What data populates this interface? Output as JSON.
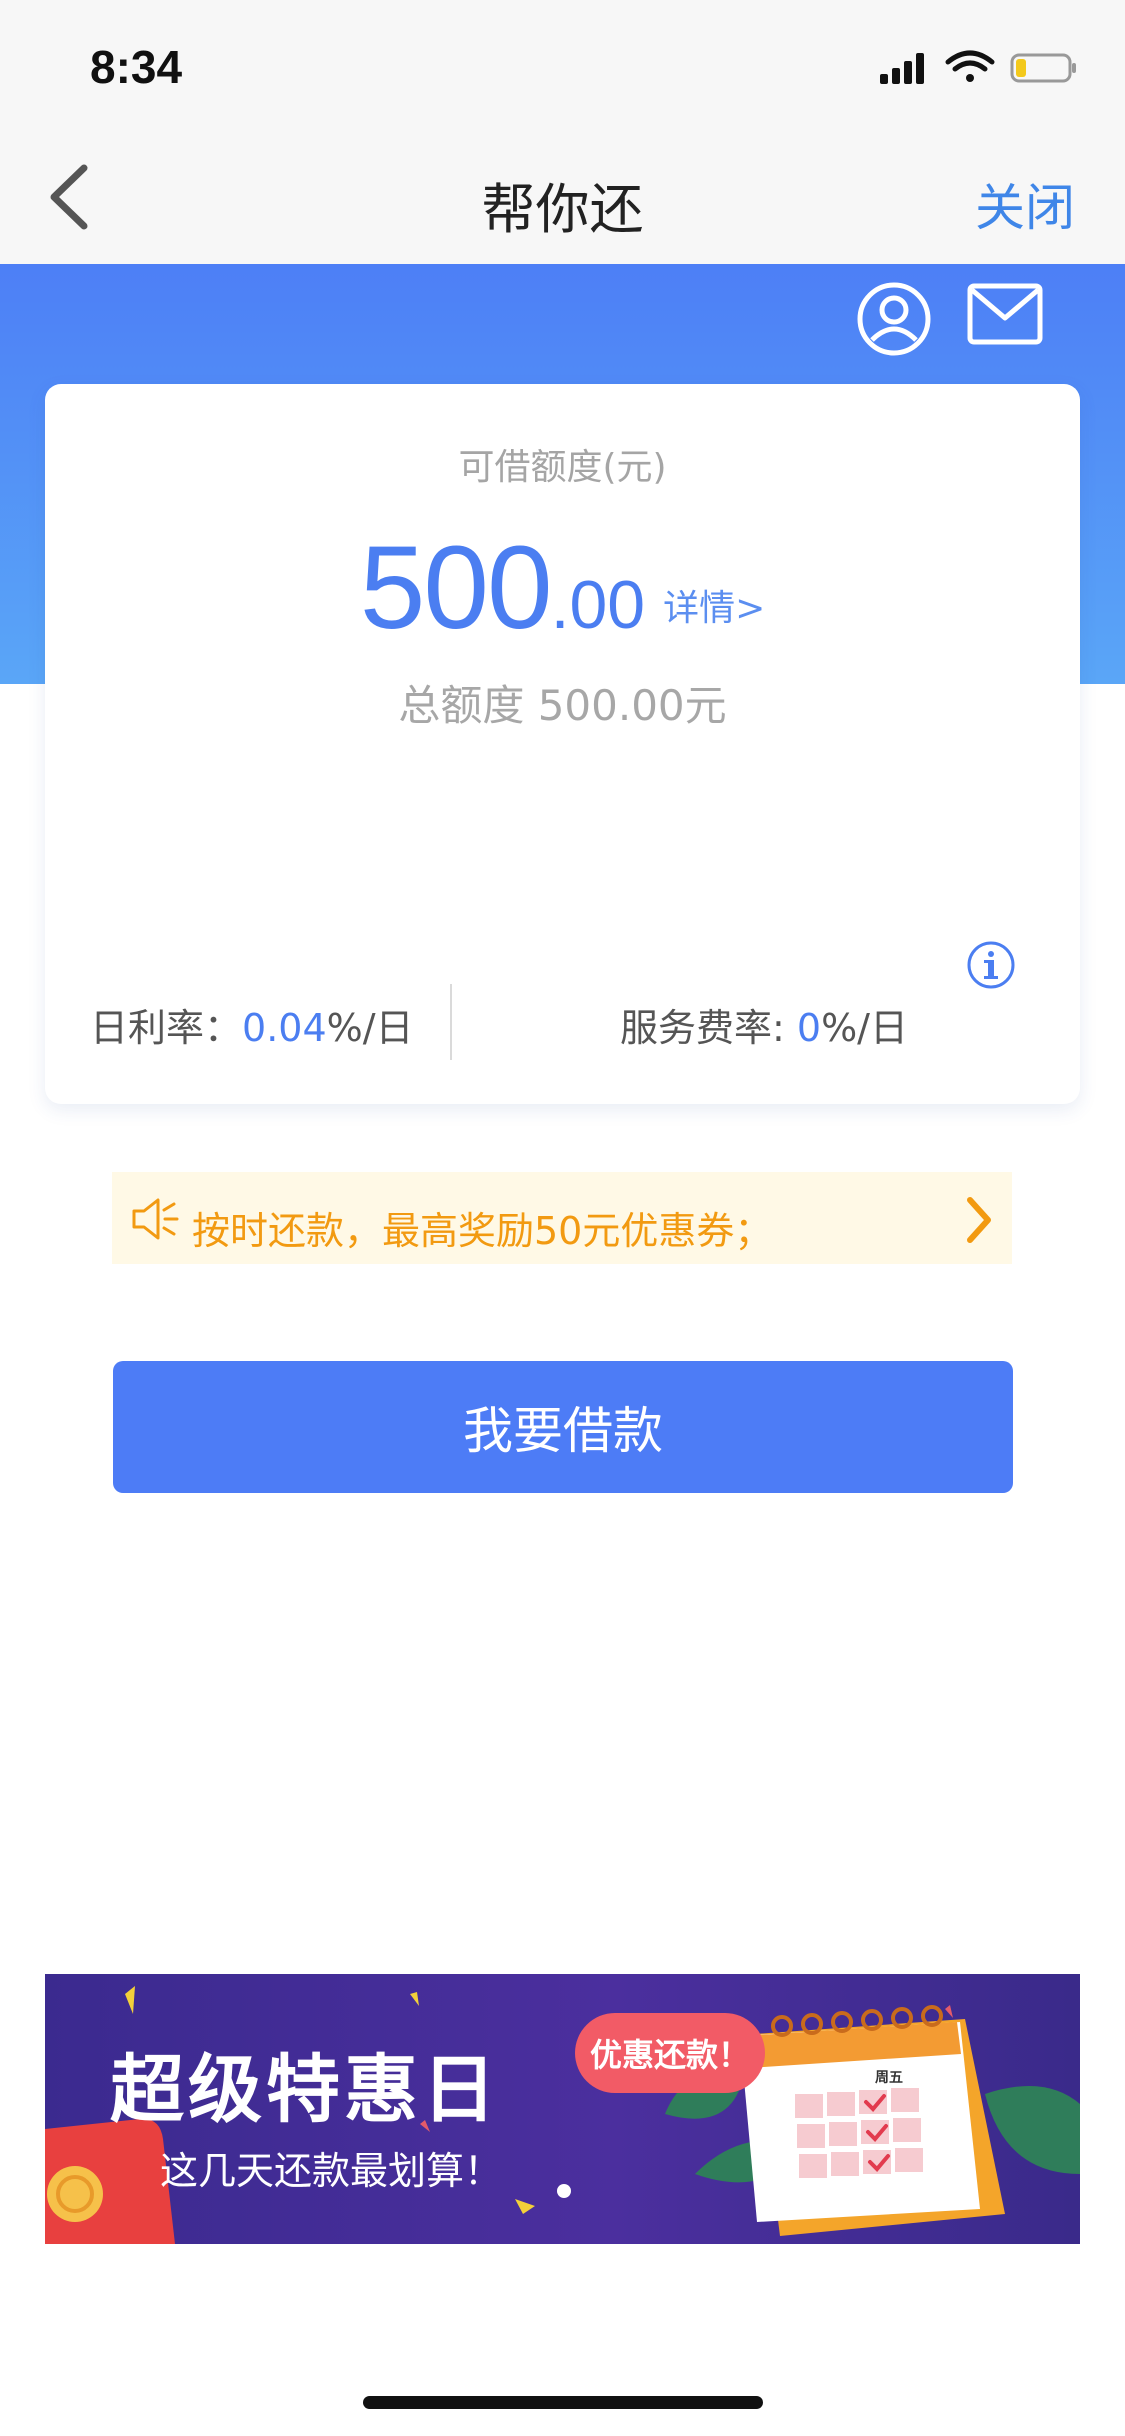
{
  "status_bar": {
    "time": "8:34"
  },
  "nav": {
    "title": "帮你还",
    "close_label": "关闭"
  },
  "card": {
    "quota_label": "可借额度(元)",
    "amount_integer": "500",
    "amount_decimal": ".00",
    "details_link": "详情>",
    "total_text": "总额度 500.00元",
    "daily_rate": {
      "label": "日利率：",
      "value": "0.04",
      "unit": "%/日"
    },
    "service_fee": {
      "label": "服务费率: ",
      "value": "0",
      "unit": "%/日"
    }
  },
  "notice": {
    "text": "按时还款，最高奖励50元优惠券；"
  },
  "borrow_button": {
    "label": "我要借款"
  },
  "banner": {
    "title": "超级特惠日",
    "subtitle": "这几天还款最划算！",
    "bubble": "优惠还款！",
    "calendar_day": "周五"
  },
  "colors": {
    "primary_blue": "#4d7cf6",
    "notice_orange": "#f29a11",
    "banner_purple": "#3b2a8f"
  }
}
